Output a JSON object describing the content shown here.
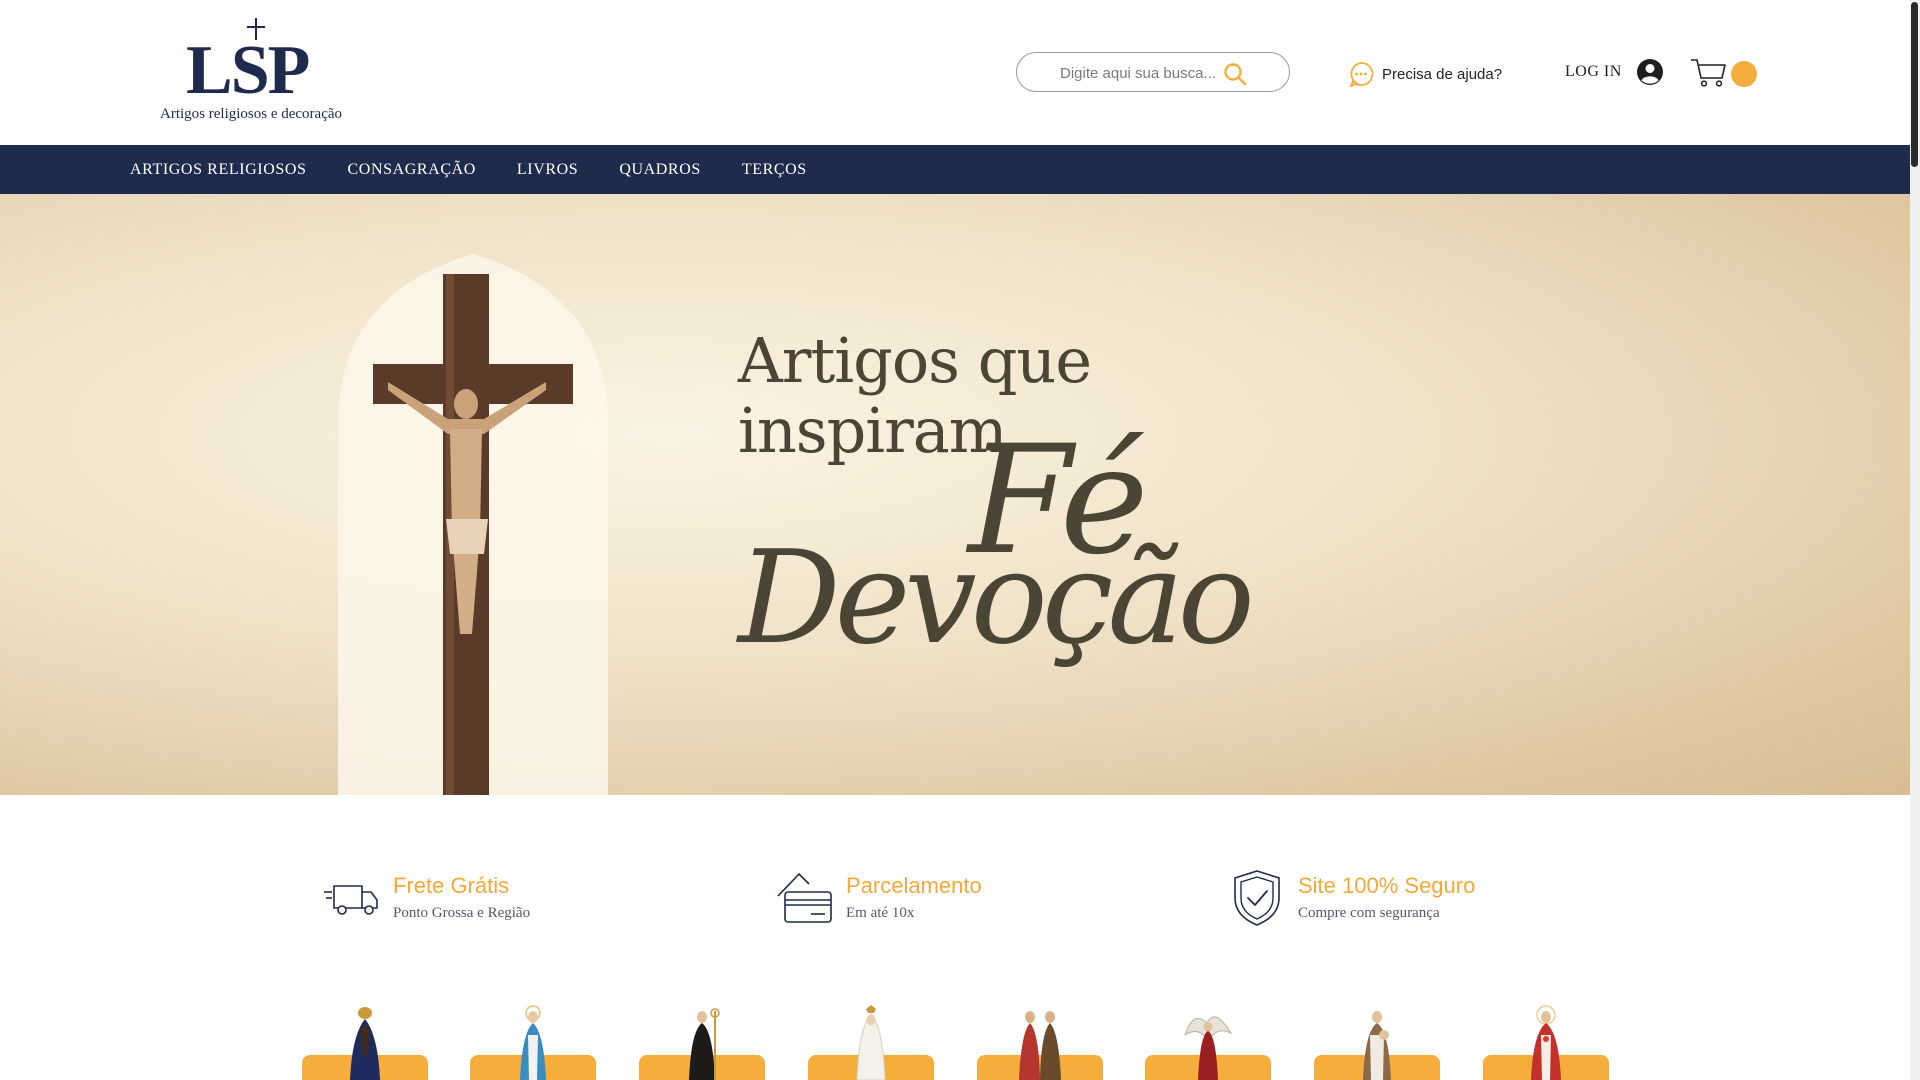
{
  "brand": {
    "mark": "LSP",
    "tagline": "Artigos religiosos e decoração"
  },
  "header": {
    "search_placeholder": "Digite aqui sua busca...",
    "help_label": "Precisa de ajuda?",
    "login_label": "LOG IN"
  },
  "nav": {
    "items": [
      {
        "label": "ARTIGOS RELIGIOSOS"
      },
      {
        "label": "CONSAGRAÇÃO"
      },
      {
        "label": "LIVROS"
      },
      {
        "label": "QUADROS"
      },
      {
        "label": "TERÇOS"
      }
    ]
  },
  "hero": {
    "line1": "Artigos que",
    "line2": "inspiram",
    "script1": "Fé",
    "script2": "Devoção"
  },
  "features": [
    {
      "icon": "truck-icon",
      "title": "Frete Grátis",
      "subtitle": "Ponto Grossa e Região"
    },
    {
      "icon": "credit-card-icon",
      "title": "Parcelamento",
      "subtitle": "Em até 10x"
    },
    {
      "icon": "shield-check-icon",
      "title": "Site 100% Seguro",
      "subtitle": "Compre com segurança"
    }
  ],
  "colors": {
    "navy": "#1f2b4d",
    "accent": "#f5ad3c",
    "feature_title": "#f3a83a"
  }
}
